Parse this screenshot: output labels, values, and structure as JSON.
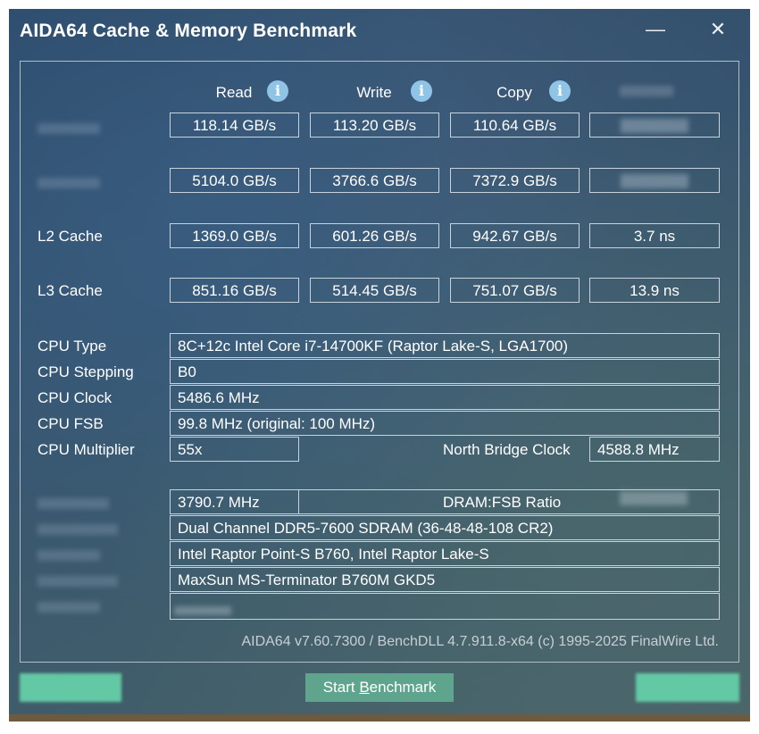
{
  "window": {
    "title": "AIDA64 Cache & Memory Benchmark",
    "minimize_glyph": "—",
    "close_glyph": "✕"
  },
  "columns": {
    "read": "Read",
    "write": "Write",
    "copy": "Copy",
    "info_icon_glyph": "i"
  },
  "results": {
    "memory": {
      "read": "118.14 GB/s",
      "write": "113.20 GB/s",
      "copy": "110.64 GB/s"
    },
    "l1": {
      "read": "5104.0 GB/s",
      "write": "3766.6 GB/s",
      "copy": "7372.9 GB/s"
    },
    "l2": {
      "label": "L2 Cache",
      "read": "1369.0 GB/s",
      "write": "601.26 GB/s",
      "copy": "942.67 GB/s",
      "latency": "3.7 ns"
    },
    "l3": {
      "label": "L3 Cache",
      "read": "851.16 GB/s",
      "write": "514.45 GB/s",
      "copy": "751.07 GB/s",
      "latency": "13.9 ns"
    }
  },
  "cpu": {
    "type_label": "CPU Type",
    "type_value": "8C+12c Intel Core i7-14700KF  (Raptor Lake-S, LGA1700)",
    "stepping_label": "CPU Stepping",
    "stepping_value": "B0",
    "clock_label": "CPU Clock",
    "clock_value": "5486.6 MHz",
    "fsb_label": "CPU FSB",
    "fsb_value": "99.8 MHz  (original: 100 MHz)",
    "multiplier_label": "CPU Multiplier",
    "multiplier_value": "55x",
    "nb_clock_label": "North Bridge Clock",
    "nb_clock_value": "4588.8 MHz"
  },
  "memory_info": {
    "bus_value": "3790.7 MHz",
    "dram_ratio_label": "DRAM:FSB Ratio",
    "memory_type_value": "Dual Channel DDR5-7600 SDRAM  (36-48-48-108 CR2)",
    "chipset_value": "Intel Raptor Point-S B760, Intel Raptor Lake-S",
    "motherboard_value": "MaxSun MS-Terminator B760M GKD5"
  },
  "footer": {
    "version": "AIDA64 v7.60.7300 / BenchDLL 4.7.911.8-x64  (c) 1995-2025 FinalWire Ltd."
  },
  "buttons": {
    "start_pre": "Start ",
    "start_accel": "B",
    "start_post": "enchmark"
  },
  "colors": {
    "button_bg": "#5fa58e",
    "panel_border": "#aebccb",
    "info_icon": "#8fc4e6"
  }
}
